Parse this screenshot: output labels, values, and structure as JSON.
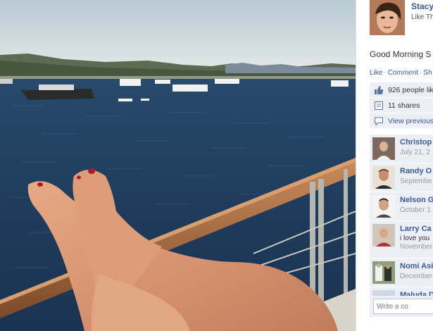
{
  "owner": {
    "name": "Stacy",
    "subtitle": "Like Th"
  },
  "post": {
    "caption": "Good Morning S"
  },
  "actions": {
    "like": "Like",
    "comment": "Comment",
    "share": "Sh",
    "separator": "·"
  },
  "ufi": {
    "likes": "926 people like",
    "shares": "11 shares",
    "view_previous": "View previous"
  },
  "comments": [
    {
      "name": "Christop",
      "text": "",
      "date": "July 21, 2"
    },
    {
      "name": "Randy O",
      "text": "",
      "date": "Septembe"
    },
    {
      "name": "Nelson G",
      "text": "",
      "date": "October 1"
    },
    {
      "name": "Larry Ca",
      "text": "i love you",
      "date": "November"
    },
    {
      "name": "Nomi Asi",
      "text": "",
      "date": "December"
    },
    {
      "name": "Maluda D",
      "text": "",
      "date": ""
    }
  ],
  "composer": {
    "placeholder": "Write a co"
  },
  "colors": {
    "link": "#3b5998",
    "ufi_bg": "#eceff5",
    "sea": "#1f3b5c",
    "sky": "#c9d6de",
    "railing": "#a86a3e"
  },
  "icons": [
    "thumbs-up-icon",
    "share-icon",
    "comment-icon"
  ]
}
